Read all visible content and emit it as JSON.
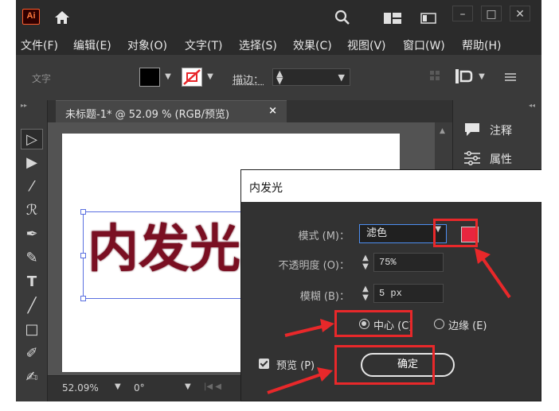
{
  "app": {
    "logo": "Ai",
    "icons": [
      "home-icon",
      "search-icon",
      "layout-icon",
      "panel-icon"
    ],
    "window_buttons": [
      "–",
      "□",
      "✕"
    ]
  },
  "menu": [
    "文件(F)",
    "编辑(E)",
    "对象(O)",
    "文字(T)",
    "选择(S)",
    "效果(C)",
    "视图(V)",
    "窗口(W)",
    "帮助(H)"
  ],
  "options_bar": {
    "context_label": "文字",
    "fill_color": "#000000",
    "stroke_color": "none",
    "stroke_label": "描边："
  },
  "document": {
    "tab_title": "未标题-1* @ 52.09 % (RGB/预览)",
    "tab_close": "×",
    "artwork_text": "内发光",
    "artwork_color": "#7a0f22",
    "zoom": "52.09%",
    "angle": "0°"
  },
  "right_panel": {
    "items": [
      "注释",
      "属性"
    ]
  },
  "tools": [
    "selection-tool",
    "direct-selection-tool",
    "magic-wand-tool",
    "lasso-tool",
    "pen-tool",
    "curvature-tool",
    "type-tool",
    "line-tool",
    "rectangle-tool",
    "paintbrush-tool",
    "shaper-tool"
  ],
  "dialog": {
    "title": "内发光",
    "mode_label": "模式 (M)：",
    "mode_value": "滤色",
    "glow_color": "#e8263f",
    "opacity_label": "不透明度 (O)：",
    "opacity_value": "75%",
    "blur_label": "模糊 (B)：",
    "blur_value": "5 px",
    "center_label": "中心 (C)",
    "edge_label": "边缘 (E)",
    "preview_label": "预览 (P)",
    "ok_label": "确定",
    "selected_option": "center",
    "preview_checked": true
  },
  "annotation_color": "#e8282a"
}
